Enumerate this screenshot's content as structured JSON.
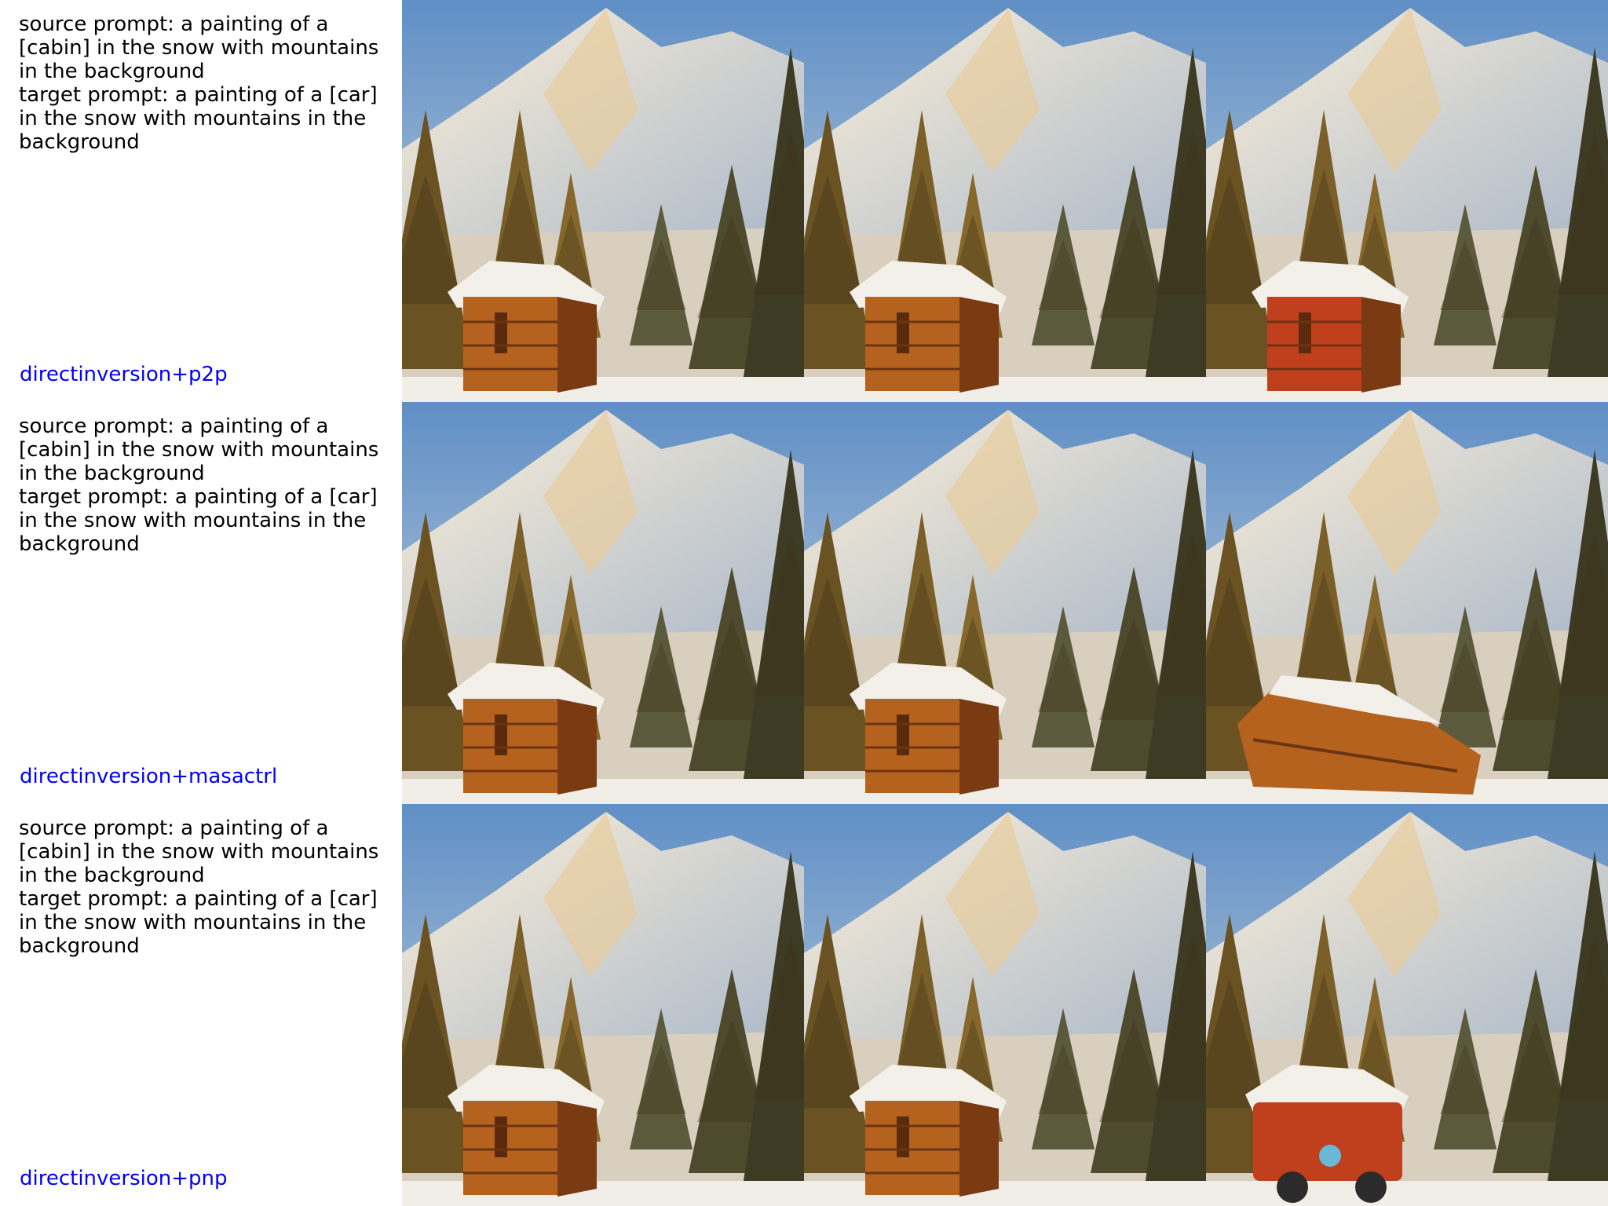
{
  "rows": [
    {
      "source_prompt": "source prompt: a painting of a [cabin] in the snow with mountains in the background",
      "target_prompt": "target prompt: a painting of a [car] in the snow with mountains in the background",
      "method": "directinversion+p2p"
    },
    {
      "source_prompt": "source prompt: a painting of a [cabin] in the snow with mountains in the background",
      "target_prompt": "target prompt: a painting of a [car] in the snow with mountains in the background",
      "method": "directinversion+masactrl"
    },
    {
      "source_prompt": "source prompt: a painting of a [cabin] in the snow with mountains in the background",
      "target_prompt": "target prompt: a painting of a [car] in the snow with mountains in the background",
      "method": "directinversion+pnp"
    }
  ],
  "colors": {
    "method_text": "#0000ff",
    "prompt_text": "#000000",
    "sky": "#6f9ac4",
    "mountain": "#f2e6d2",
    "cabin": "#b5621f",
    "cabin_red": "#c0401e",
    "tree": "#5a4a22"
  }
}
